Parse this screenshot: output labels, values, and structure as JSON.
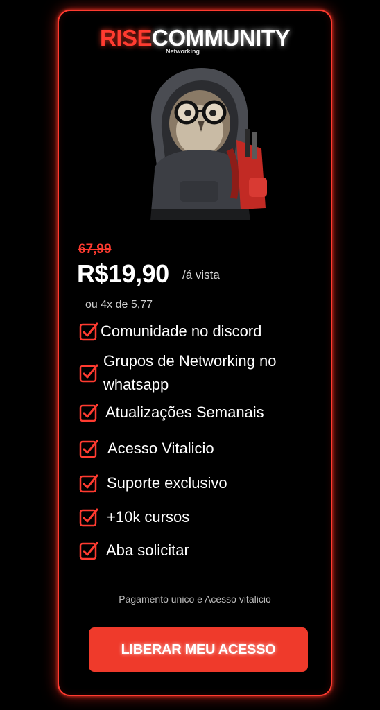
{
  "brand": {
    "rise": "RISE",
    "community": "COMMUNITY",
    "subtitle": "Networking"
  },
  "pricing": {
    "old_price": "67,99",
    "price": "R$19,90",
    "price_suffix": "/á vista",
    "installments": "ou 4x de 5,77"
  },
  "features": [
    {
      "label": "Comunidade no discord"
    },
    {
      "label": "Grupos de Networking no whatsapp"
    },
    {
      "label": "Atualizações Semanais"
    },
    {
      "label": "Acesso Vitalicio"
    },
    {
      "label": "Suporte exclusivo"
    },
    {
      "label": "+10k cursos"
    },
    {
      "label": "Aba solicitar"
    }
  ],
  "note": "Pagamento unico e Acesso vitalicio",
  "cta": {
    "label": "LIBERAR MEU ACESSO"
  },
  "colors": {
    "accent": "#ff3b30",
    "button": "#ef3a2b",
    "background": "#000000",
    "text": "#ffffff"
  },
  "icons": {
    "feature_check": "checkbox-check-icon",
    "mascot": "owl-mascot"
  }
}
